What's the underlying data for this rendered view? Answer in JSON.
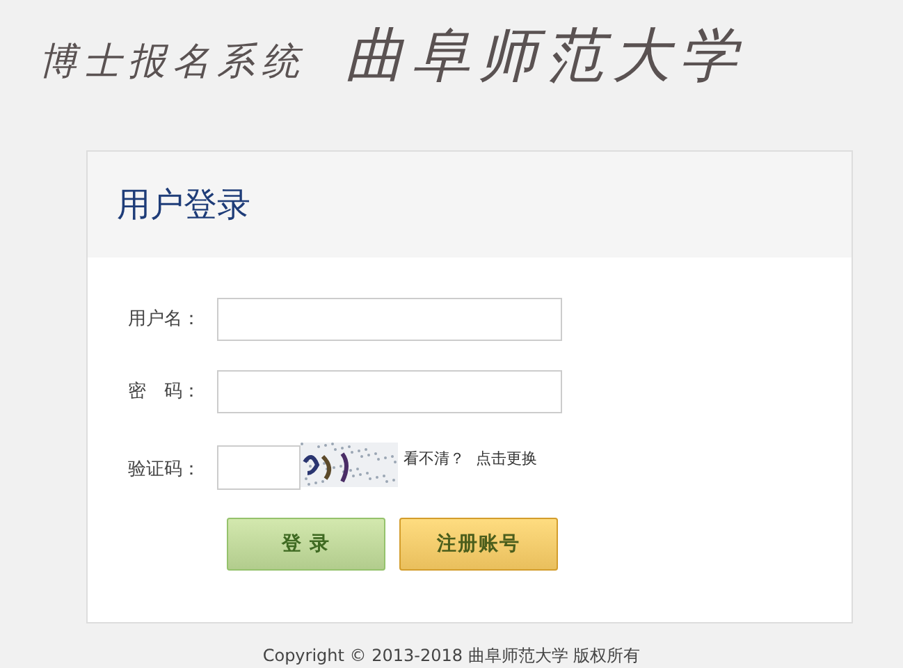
{
  "header": {
    "system_name": "博士报名系统",
    "university_name": "曲阜师范大学"
  },
  "login_panel": {
    "title": "用户登录",
    "fields": [
      {
        "label": "用户名："
      },
      {
        "label": "密　码："
      }
    ],
    "captcha": {
      "label": "验证码：",
      "hint": "看不清？",
      "refresh_link": "点击更换"
    },
    "buttons": [
      {
        "label": "登 录",
        "kind": "primary"
      },
      {
        "label": "注册账号",
        "kind": "secondary"
      }
    ]
  },
  "footer": {
    "copyright": "Copyright © 2013-2018 曲阜师范大学  版权所有"
  }
}
